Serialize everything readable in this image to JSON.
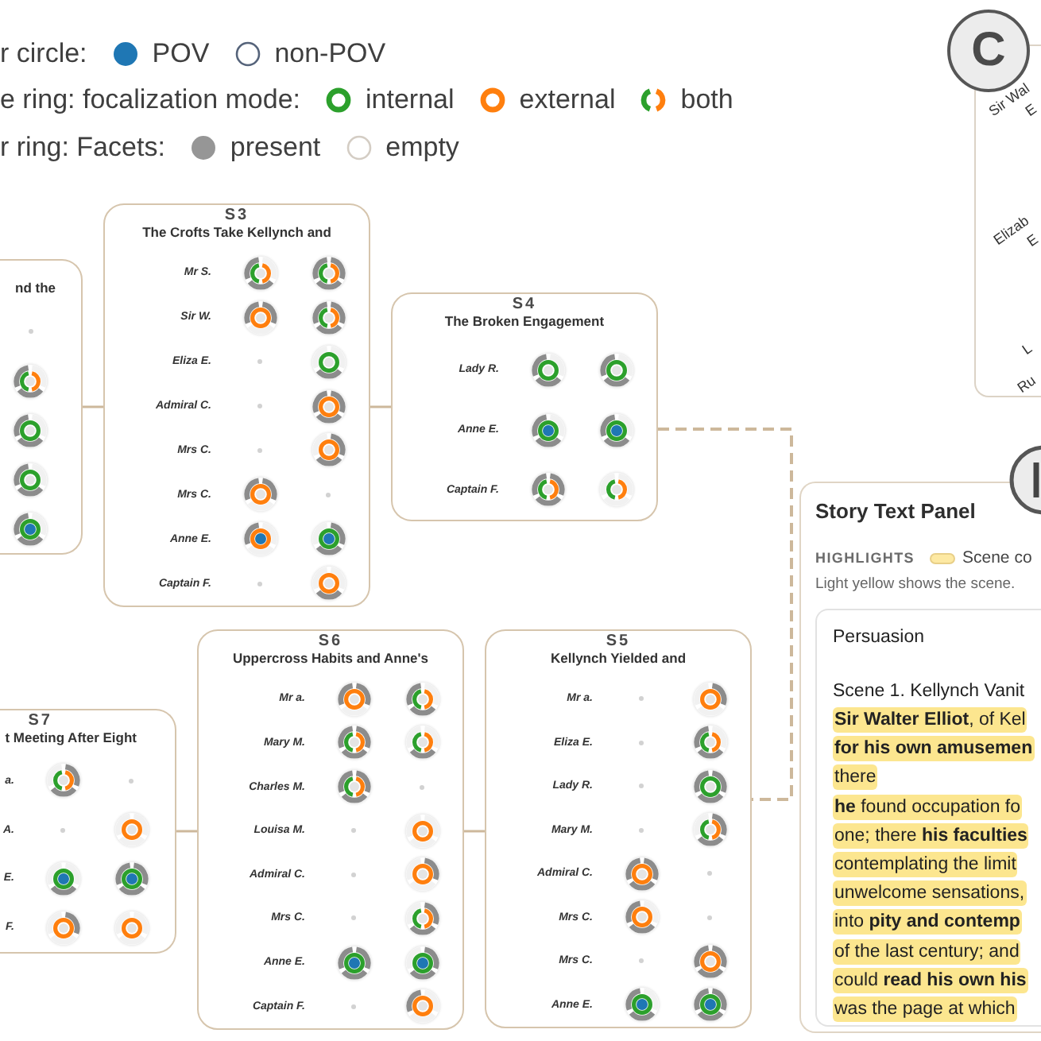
{
  "legend": [
    {
      "title": "r circle:",
      "items": [
        {
          "kind": "pov",
          "label": "POV"
        },
        {
          "kind": "non-pov",
          "label": "non-POV"
        }
      ]
    },
    {
      "title": "e ring: focalization mode:",
      "items": [
        {
          "kind": "internal",
          "label": "internal"
        },
        {
          "kind": "external",
          "label": "external"
        },
        {
          "kind": "both",
          "label": "both"
        }
      ]
    },
    {
      "title": "r ring: Facets:",
      "items": [
        {
          "kind": "present",
          "label": "present"
        },
        {
          "kind": "empty",
          "label": "empty"
        }
      ]
    }
  ],
  "scenes": [
    {
      "title": "nd the",
      "rows": [
        {
          "cells": [
            {
              "kind": "absent"
            }
          ]
        },
        {
          "cells": [
            {
              "kind": "both",
              "pov": false,
              "facets": [
                false,
                true,
                true
              ]
            }
          ]
        },
        {
          "cells": [
            {
              "kind": "internal",
              "pov": false,
              "facets": [
                false,
                true,
                true
              ]
            }
          ]
        },
        {
          "cells": [
            {
              "kind": "internal",
              "pov": false,
              "facets": [
                false,
                true,
                true
              ]
            }
          ]
        },
        {
          "cells": [
            {
              "kind": "internal",
              "pov": true,
              "facets": [
                false,
                true,
                true
              ]
            }
          ]
        }
      ]
    },
    {
      "number": "S3",
      "title": "The Crofts Take Kellynch and",
      "rows": [
        {
          "label": "Mr S.",
          "cells": [
            {
              "kind": "both",
              "pov": false,
              "facets": [
                false,
                true,
                true
              ]
            },
            {
              "kind": "both",
              "pov": false,
              "facets": [
                true,
                true,
                true
              ]
            }
          ]
        },
        {
          "label": "Sir W.",
          "cells": [
            {
              "kind": "external",
              "pov": false,
              "facets": [
                true,
                false,
                true
              ]
            },
            {
              "kind": "both",
              "pov": false,
              "facets": [
                true,
                true,
                true
              ]
            }
          ]
        },
        {
          "label": "Eliza E.",
          "cells": [
            {
              "kind": "absent"
            },
            {
              "kind": "internal",
              "pov": false,
              "facets": [
                false,
                true,
                false
              ]
            }
          ]
        },
        {
          "label": "Admiral C.",
          "cells": [
            {
              "kind": "absent"
            },
            {
              "kind": "external",
              "pov": false,
              "facets": [
                true,
                true,
                true
              ]
            }
          ]
        },
        {
          "label": "Mrs C.",
          "cells": [
            {
              "kind": "absent"
            },
            {
              "kind": "external",
              "pov": false,
              "facets": [
                true,
                true,
                false
              ]
            }
          ]
        },
        {
          "label": "Mrs C.",
          "cells": [
            {
              "kind": "external",
              "pov": false,
              "facets": [
                true,
                false,
                true
              ]
            },
            {
              "kind": "absent"
            }
          ]
        },
        {
          "label": "Anne E.",
          "cells": [
            {
              "kind": "external",
              "pov": true,
              "facets": [
                false,
                false,
                true
              ]
            },
            {
              "kind": "internal",
              "pov": true,
              "facets": [
                true,
                true,
                false
              ]
            }
          ]
        },
        {
          "label": "Captain F.",
          "cells": [
            {
              "kind": "absent"
            },
            {
              "kind": "external",
              "pov": false,
              "facets": [
                false,
                true,
                false
              ]
            }
          ]
        }
      ]
    },
    {
      "number": "S4",
      "title": "The Broken Engagement",
      "rows": [
        {
          "label": "Lady R.",
          "cells": [
            {
              "kind": "internal",
              "pov": false,
              "facets": [
                false,
                true,
                true
              ]
            },
            {
              "kind": "internal",
              "pov": false,
              "facets": [
                false,
                true,
                true
              ]
            }
          ]
        },
        {
          "label": "Anne E.",
          "cells": [
            {
              "kind": "internal",
              "pov": true,
              "facets": [
                false,
                true,
                true
              ]
            },
            {
              "kind": "internal",
              "pov": true,
              "facets": [
                false,
                true,
                true
              ]
            }
          ]
        },
        {
          "label": "Captain F.",
          "cells": [
            {
              "kind": "both",
              "pov": false,
              "facets": [
                true,
                true,
                true
              ]
            },
            {
              "kind": "both",
              "pov": false,
              "facets": [
                false,
                false,
                false
              ]
            }
          ]
        }
      ]
    },
    {
      "number": "S7",
      "title": "t Meeting After Eight",
      "rows": [
        {
          "label": "a.",
          "cells": [
            {
              "kind": "both",
              "pov": false,
              "facets": [
                true,
                true,
                false
              ]
            },
            {
              "kind": "absent"
            }
          ]
        },
        {
          "label": "A.",
          "cells": [
            {
              "kind": "absent"
            },
            {
              "kind": "external",
              "pov": false,
              "facets": [
                false,
                false,
                false
              ]
            }
          ]
        },
        {
          "label": "E.",
          "cells": [
            {
              "kind": "internal",
              "pov": true,
              "facets": [
                false,
                true,
                false
              ]
            },
            {
              "kind": "internal",
              "pov": true,
              "facets": [
                true,
                true,
                true
              ]
            }
          ]
        },
        {
          "label": "F.",
          "cells": [
            {
              "kind": "external",
              "pov": false,
              "facets": [
                true,
                false,
                false
              ]
            },
            {
              "kind": "external",
              "pov": false,
              "facets": [
                false,
                false,
                false
              ]
            }
          ]
        }
      ]
    },
    {
      "number": "S6",
      "title": "Uppercross Habits and Anne's",
      "rows": [
        {
          "label": "Mr a.",
          "cells": [
            {
              "kind": "external",
              "pov": false,
              "facets": [
                true,
                false,
                true
              ]
            },
            {
              "kind": "both",
              "pov": false,
              "facets": [
                false,
                true,
                true
              ]
            }
          ]
        },
        {
          "label": "Mary M.",
          "cells": [
            {
              "kind": "both",
              "pov": false,
              "facets": [
                true,
                true,
                true
              ]
            },
            {
              "kind": "both",
              "pov": false,
              "facets": [
                false,
                true,
                false
              ]
            }
          ]
        },
        {
          "label": "Charles M.",
          "cells": [
            {
              "kind": "both",
              "pov": false,
              "facets": [
                true,
                true,
                true
              ]
            },
            {
              "kind": "absent"
            }
          ]
        },
        {
          "label": "Louisa M.",
          "cells": [
            {
              "kind": "absent"
            },
            {
              "kind": "external",
              "pov": false,
              "facets": [
                false,
                false,
                false
              ]
            }
          ]
        },
        {
          "label": "Admiral C.",
          "cells": [
            {
              "kind": "absent"
            },
            {
              "kind": "external",
              "pov": false,
              "facets": [
                true,
                false,
                false
              ]
            }
          ]
        },
        {
          "label": "Mrs C.",
          "cells": [
            {
              "kind": "absent"
            },
            {
              "kind": "both",
              "pov": false,
              "facets": [
                true,
                true,
                false
              ]
            }
          ]
        },
        {
          "label": "Anne E.",
          "cells": [
            {
              "kind": "internal",
              "pov": true,
              "facets": [
                true,
                true,
                true
              ]
            },
            {
              "kind": "internal",
              "pov": true,
              "facets": [
                true,
                true,
                false
              ]
            }
          ]
        },
        {
          "label": "Captain F.",
          "cells": [
            {
              "kind": "absent"
            },
            {
              "kind": "external",
              "pov": false,
              "facets": [
                false,
                false,
                true
              ]
            }
          ]
        }
      ]
    },
    {
      "number": "S5",
      "title": "Kellynch Yielded and",
      "rows": [
        {
          "label": "Mr a.",
          "cells": [
            {
              "kind": "absent"
            },
            {
              "kind": "external",
              "pov": false,
              "facets": [
                true,
                false,
                false
              ]
            }
          ]
        },
        {
          "label": "Eliza E.",
          "cells": [
            {
              "kind": "absent"
            },
            {
              "kind": "both",
              "pov": false,
              "facets": [
                false,
                true,
                true
              ]
            }
          ]
        },
        {
          "label": "Lady R.",
          "cells": [
            {
              "kind": "absent"
            },
            {
              "kind": "internal",
              "pov": false,
              "facets": [
                true,
                true,
                true
              ]
            }
          ]
        },
        {
          "label": "Mary M.",
          "cells": [
            {
              "kind": "absent"
            },
            {
              "kind": "both",
              "pov": false,
              "facets": [
                true,
                true,
                false
              ]
            }
          ]
        },
        {
          "label": "Admiral C.",
          "cells": [
            {
              "kind": "external",
              "pov": false,
              "facets": [
                true,
                true,
                true
              ]
            },
            {
              "kind": "absent"
            }
          ]
        },
        {
          "label": "Mrs C.",
          "cells": [
            {
              "kind": "external",
              "pov": false,
              "facets": [
                false,
                true,
                true
              ]
            },
            {
              "kind": "absent"
            }
          ]
        },
        {
          "label": "Mrs C.",
          "cells": [
            {
              "kind": "absent"
            },
            {
              "kind": "external",
              "pov": false,
              "facets": [
                true,
                true,
                true
              ]
            }
          ]
        },
        {
          "label": "Anne E.",
          "cells": [
            {
              "kind": "internal",
              "pov": true,
              "facets": [
                false,
                true,
                true
              ]
            },
            {
              "kind": "internal",
              "pov": true,
              "facets": [
                true,
                true,
                true
              ]
            }
          ]
        }
      ]
    }
  ],
  "panel_c": {
    "badge": "C",
    "labels": [
      {
        "lines": [
          "Sir Wal",
          "E"
        ]
      },
      {
        "lines": [
          "Elizab",
          "E"
        ]
      },
      {
        "lines": [
          "L",
          "Ru"
        ]
      }
    ]
  },
  "story_panel": {
    "title": "Story Text Panel",
    "highlights_label": "HIGHLIGHTS",
    "highlight_legend": "Scene co",
    "note": "Light yellow shows the scene.",
    "document": {
      "title": "Persuasion",
      "heading": "Scene 1. Kellynch Vanit",
      "lines": [
        {
          "text": "**Sir Walter Elliot**, of Kel",
          "highlighted": true
        },
        {
          "text": "**for his own amusemen**",
          "highlighted": true
        },
        {
          "text": "there",
          "highlighted": true
        },
        {
          "text": "**he** found occupation fo",
          "highlighted": true
        },
        {
          "text": "one; there **his faculties**",
          "highlighted": true
        },
        {
          "text": "contemplating the limit",
          "highlighted": true
        },
        {
          "text": "unwelcome sensations,",
          "highlighted": true
        },
        {
          "text": "into **pity and contemp**",
          "highlighted": true
        },
        {
          "text": "of the last century; and",
          "highlighted": true
        },
        {
          "text": "could **read his own his**",
          "highlighted": true
        },
        {
          "text": "was the page at which",
          "highlighted": true
        }
      ]
    }
  }
}
